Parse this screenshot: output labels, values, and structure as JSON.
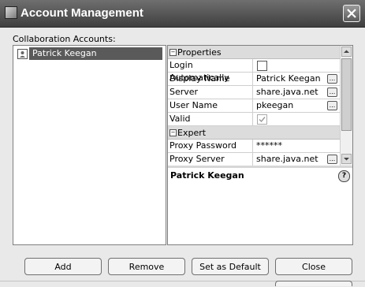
{
  "window": {
    "title": "Account Management",
    "close_icon": "close-icon"
  },
  "accounts": {
    "label": "Collaboration Accounts:",
    "items": [
      {
        "name": "Patrick Keegan",
        "icon": "user-icon",
        "selected": true
      }
    ]
  },
  "properties": {
    "categories": [
      {
        "label": "Properties",
        "rows": [
          {
            "name": "Login Automatically",
            "type": "checkbox",
            "checked": false
          },
          {
            "name": "Display Name",
            "value": "Patrick Keegan",
            "ellipsis": "..."
          },
          {
            "name": "Server",
            "value": "share.java.net",
            "ellipsis": "..."
          },
          {
            "name": "User Name",
            "value": "pkeegan",
            "ellipsis": "..."
          },
          {
            "name": "Valid",
            "type": "checkbox",
            "checked": true,
            "disabled": true
          }
        ]
      },
      {
        "label": "Expert",
        "rows": [
          {
            "name": "Proxy Password",
            "value": "******"
          },
          {
            "name": "Proxy Server",
            "value": "share.java.net",
            "ellipsis": "..."
          }
        ]
      }
    ],
    "description_title": "Patrick Keegan",
    "help_icon": "?"
  },
  "buttons": {
    "add": "Add",
    "remove": "Remove",
    "set_default": "Set as Default",
    "close": "Close"
  },
  "colors": {
    "titlebar": "#4f4f4f",
    "selection": "#5a5a5a",
    "category_bg": "#dcdcdc"
  }
}
